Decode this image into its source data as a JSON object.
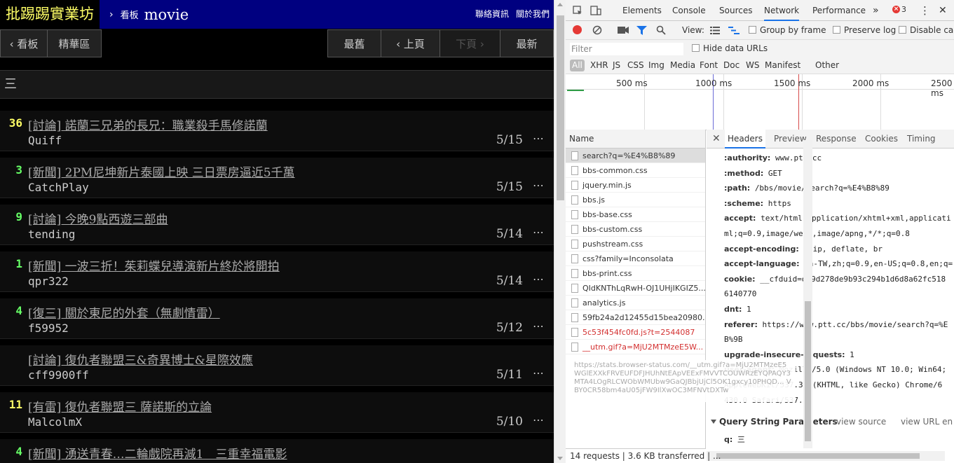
{
  "ptt": {
    "logo": "批踢踢實業坊",
    "crumb_sep": "›",
    "crumb_label": "看板",
    "board": "movie",
    "links": [
      "聯絡資訊",
      "關於我們"
    ],
    "nav": {
      "board": "‹ 看板",
      "digest": "精華區",
      "oldest": "最舊",
      "prev": "‹ 上頁",
      "next": "下頁 ›",
      "newest": "最新"
    },
    "search_value": "三",
    "more_glyph": "⋯",
    "posts": [
      {
        "count": "36",
        "count_color": "#ffff66",
        "title": "[討論] 諾蘭三兄弟的長兄：職業殺手馬修諾蘭",
        "author": "Quiff",
        "date": "5/15"
      },
      {
        "count": "3",
        "count_color": "#66ff66",
        "title": "[新聞] 2PM尼坤新片泰國上映 三日票房逼近5千萬",
        "author": "CatchPlay",
        "date": "5/15"
      },
      {
        "count": "9",
        "count_color": "#66ff66",
        "title": "[討論] 今晚9點西遊三部曲",
        "author": "tending",
        "date": "5/14"
      },
      {
        "count": "1",
        "count_color": "#66ff66",
        "title": "[新聞] 一波三折！茱莉蝶兒導演新片終於將開拍",
        "author": "qpr322",
        "date": "5/14"
      },
      {
        "count": "4",
        "count_color": "#66ff66",
        "title": "[復三] 關於東尼的外套（無劇情雷）",
        "author": "f59952",
        "date": "5/12"
      },
      {
        "count": "",
        "count_color": "#66ff66",
        "title": "[討論] 復仇者聯盟三&奇異博士&星際效應",
        "author": "cff9900ff",
        "date": "5/11"
      },
      {
        "count": "11",
        "count_color": "#ffff66",
        "title": "[有雷] 復仇者聯盟三 薩諾斯的立論",
        "author": "MalcolmX",
        "date": "5/10"
      },
      {
        "count": "4",
        "count_color": "#66ff66",
        "title": "[新聞] 湧送青春…二輪戲院再減1　三重幸福電影",
        "author": "",
        "date": ""
      }
    ]
  },
  "devtools": {
    "tabs": [
      "Elements",
      "Console",
      "Sources",
      "Network",
      "Performance",
      "»"
    ],
    "error_count": "3",
    "more_menu": "⋮",
    "close": "✕",
    "toolbar": {
      "view": "View:",
      "group_by_frame": "Group by frame",
      "preserve_log": "Preserve log",
      "disable_cache": "Disable cache"
    },
    "filter_placeholder": "Filter",
    "hide_data_urls": "Hide data URLs",
    "types": [
      "All",
      "XHR",
      "JS",
      "CSS",
      "Img",
      "Media",
      "Font",
      "Doc",
      "WS",
      "Manifest",
      "Other"
    ],
    "timeline_ticks": [
      "500 ms",
      "1000 ms",
      "1500 ms",
      "2000 ms",
      "2500 ms"
    ],
    "name_header": "Name",
    "requests": [
      {
        "name": "search?q=%E4%B8%89",
        "selected": true,
        "red": false
      },
      {
        "name": "bbs-common.css",
        "selected": false,
        "red": false
      },
      {
        "name": "jquery.min.js",
        "selected": false,
        "red": false
      },
      {
        "name": "bbs.js",
        "selected": false,
        "red": false
      },
      {
        "name": "bbs-base.css",
        "selected": false,
        "red": false
      },
      {
        "name": "bbs-custom.css",
        "selected": false,
        "red": false
      },
      {
        "name": "pushstream.css",
        "selected": false,
        "red": false
      },
      {
        "name": "css?family=Inconsolata",
        "selected": false,
        "red": false
      },
      {
        "name": "bbs-print.css",
        "selected": false,
        "red": false
      },
      {
        "name": "QIdKNThLqRwH-OJ1UHjIKGIZ5...",
        "selected": false,
        "red": false
      },
      {
        "name": "analytics.js",
        "selected": false,
        "red": false
      },
      {
        "name": "59fb24a2d12455d15bea20980...",
        "selected": false,
        "red": false
      },
      {
        "name": "5c53f454fc0fd.js?t=2544087",
        "selected": false,
        "red": true
      },
      {
        "name": "__utm.gif?a=MjU2MTMzeE5W...",
        "selected": false,
        "red": true
      }
    ],
    "tooltip": "https://stats.browser-status.com/__utm.gif?a=MjU2MTMzeE5WGlEXXkFRVEUFDFJHUhNtEApVEExFMVVTCOUWRzEYQPAQY3MTA4LOgRLCWObWMUbw9GaQJBbjUjCl5OK1gxcy10PHQD... VBY0CR58bm4aU05jFW9IlXwOC3MFNVtDXTw",
    "detail_tabs": [
      "Headers",
      "Preview",
      "Response",
      "Cookies",
      "Timing"
    ],
    "headers": [
      {
        "k": ":authority:",
        "v": "www.ptt.cc"
      },
      {
        "k": ":method:",
        "v": "GET"
      },
      {
        "k": ":path:",
        "v": "/bbs/movie/search?q=%E4%B8%89"
      },
      {
        "k": ":scheme:",
        "v": "https"
      },
      {
        "k": "accept:",
        "v": "text/html,application/xhtml+xml,applicati"
      },
      {
        "k": "",
        "v": "ml;q=0.9,image/webp,image/apng,*/*;q=0.8"
      },
      {
        "k": "accept-encoding:",
        "v": "gzip, deflate, br"
      },
      {
        "k": "accept-language:",
        "v": "zh-TW,zh;q=0.9,en-US;q=0.8,en;q="
      },
      {
        "k": "cookie:",
        "v": "__cfduid=d29d278de9b93c294b1d6d8a62fc518"
      },
      {
        "k": "",
        "v": "6140770"
      },
      {
        "k": "dnt:",
        "v": "1"
      },
      {
        "k": "referer:",
        "v": "https://www.ptt.cc/bbs/movie/search?q=%E"
      },
      {
        "k": "",
        "v": "B%9B"
      },
      {
        "k": "upgrade-insecure-requests:",
        "v": "1"
      },
      {
        "k": "user-agent:",
        "v": "Mozilla/5.0 (Windows NT 10.0; Win64;"
      },
      {
        "k": "",
        "v": "AppleWebKit/537.36 (KHTML, like Gecko) Chrome/6"
      },
      {
        "k": "",
        "v": "430.0 Safari/537.36"
      }
    ],
    "qsp_title": "Query String Parameters",
    "view_source": "view source",
    "view_url": "view URL en",
    "qsp_key": "q:",
    "qsp_value": "三",
    "status": "14 requests | 3.6 KB transferred | ..."
  }
}
